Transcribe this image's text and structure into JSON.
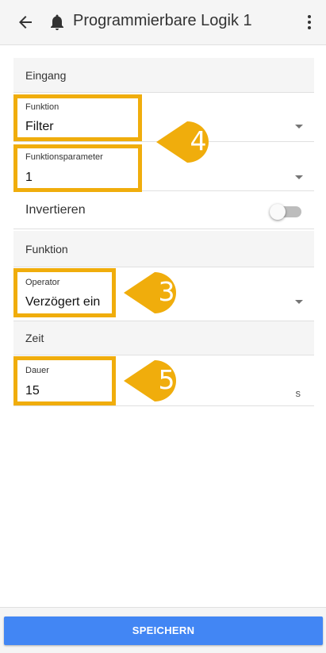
{
  "appbar": {
    "title": "Programmierbare Logik 1",
    "back_icon": "arrow-back-icon",
    "bell_icon": "bell-icon",
    "more_icon": "more-vert-icon"
  },
  "sections": {
    "eingang": "Eingang",
    "funktion": "Funktion",
    "zeit": "Zeit"
  },
  "fields": {
    "funktion": {
      "label": "Funktion",
      "value": "Filter"
    },
    "funktionsparameter": {
      "label": "Funktionsparameter",
      "value": "1"
    },
    "operator": {
      "label": "Operator",
      "value": "Verzögert ein"
    },
    "dauer": {
      "label": "Dauer",
      "value": "15",
      "unit": "s"
    }
  },
  "toggle": {
    "label": "Invertieren",
    "on": false
  },
  "callouts": {
    "a": "4",
    "b": "3",
    "c": "5"
  },
  "colors": {
    "highlight": "#f0ad0c",
    "button": "#4286f4"
  },
  "footer": {
    "save_label": "SPEICHERN"
  }
}
